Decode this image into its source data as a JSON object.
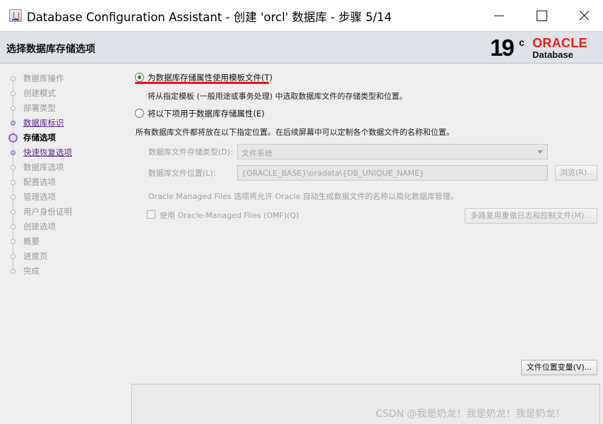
{
  "window": {
    "title": "Database Configuration Assistant - 创建 'orcl' 数据库 - 步骤 5/14"
  },
  "header": {
    "page_heading": "选择数据库存储选项",
    "logo": {
      "version": "19",
      "version_suffix": "c",
      "brand": "ORACLE",
      "product": "Database",
      "brand_color": "#e2231a"
    }
  },
  "steps": [
    {
      "label": "数据库操作",
      "state": "pending"
    },
    {
      "label": "创建模式",
      "state": "pending"
    },
    {
      "label": "部署类型",
      "state": "pending"
    },
    {
      "label": "数据库标识",
      "state": "done"
    },
    {
      "label": "存储选项",
      "state": "current"
    },
    {
      "label": "快速恢复选项",
      "state": "done"
    },
    {
      "label": "数据库选项",
      "state": "pending"
    },
    {
      "label": "配置选项",
      "state": "pending"
    },
    {
      "label": "管理选项",
      "state": "pending"
    },
    {
      "label": "用户身份证明",
      "state": "pending"
    },
    {
      "label": "创建选项",
      "state": "pending"
    },
    {
      "label": "概要",
      "state": "pending"
    },
    {
      "label": "进度页",
      "state": "pending"
    },
    {
      "label": "完成",
      "state": "pending"
    }
  ],
  "options": {
    "template": {
      "label": "为数据库存储属性使用模板文件(T)",
      "description": "将从指定模板 (一般用途或事务处理) 中选取数据库文件的存储类型和位置。",
      "selected": true
    },
    "custom": {
      "label": "将以下项用于数据库存储属性(E)",
      "description": "所有数据库文件都将放在以下指定位置。在后续屏幕中可以定制各个数据文件的名称和位置。",
      "selected": false
    }
  },
  "storage_form": {
    "storage_type_label": "数据库文件存储类型(D):",
    "storage_type_value": "文件系统",
    "location_label": "数据库文件位置(L):",
    "location_value": "{ORACLE_BASE}\\oradata\\{DB_UNIQUE_NAME}",
    "browse_button": "浏览(R)...",
    "omf_note": "Oracle Managed Files 选项将允许 Oracle 自动生成数据文件的名称以简化数据库管理。",
    "omf_checkbox_label": "使用 Oracle-Managed Files (OMF)(Q)",
    "multiplex_button": "多路复用重做日志和控制文件(M)..."
  },
  "file_location_variables_button": "文件位置变量(V)...",
  "watermark": "CSDN @我是奶龙！我是奶龙！我是奶龙！"
}
